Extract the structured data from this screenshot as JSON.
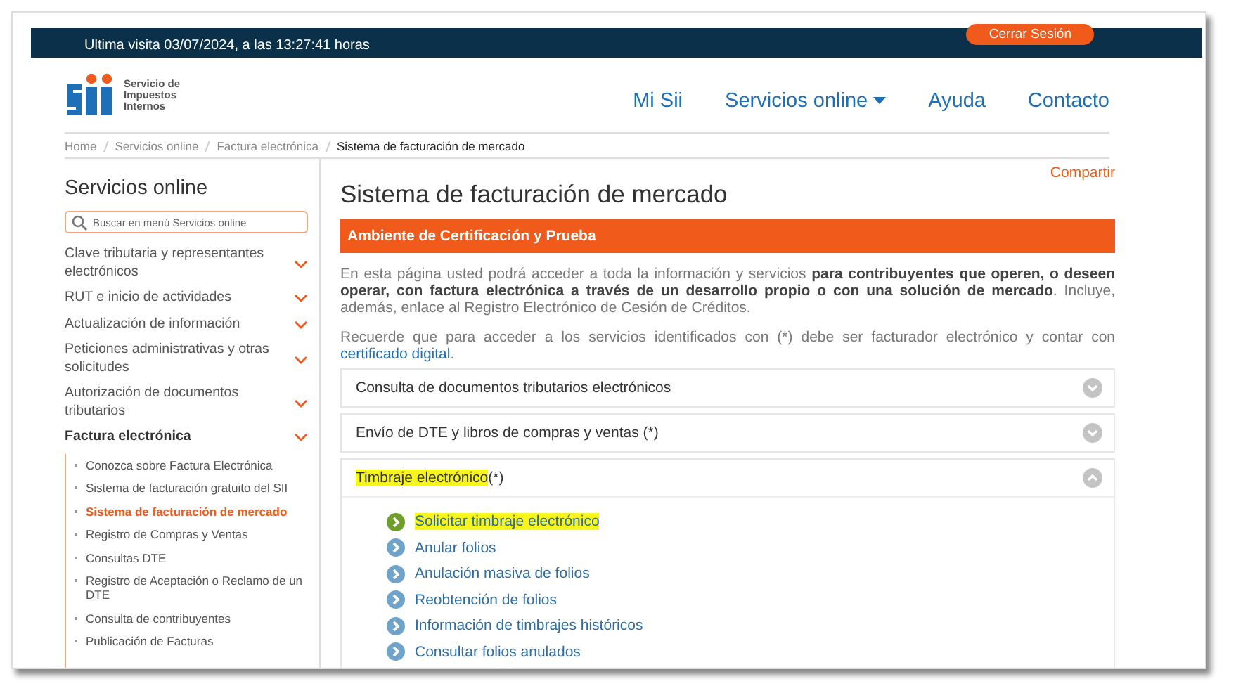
{
  "top_bar": {
    "last_visit": "Ultima visita 03/07/2024, a las 13:27:41 horas",
    "logout_button": "Cerrar Sesión"
  },
  "logo": {
    "lines": [
      "Servicio de",
      "Impuestos",
      "Internos"
    ]
  },
  "nav": [
    {
      "label": "Mi Sii",
      "dropdown": false
    },
    {
      "label": "Servicios online",
      "dropdown": true
    },
    {
      "label": "Ayuda",
      "dropdown": false
    },
    {
      "label": "Contacto",
      "dropdown": false
    }
  ],
  "breadcrumb": [
    "Home",
    "Servicios online",
    "Factura electrónica",
    "Sistema de facturación de mercado"
  ],
  "sidebar": {
    "title": "Servicios online",
    "search": {
      "placeholder": "Buscar en menú Servicios online"
    },
    "items": [
      {
        "label": "Clave tributaria y representantes electrónicos",
        "expanded": false
      },
      {
        "label": "RUT e inicio de actividades",
        "expanded": false
      },
      {
        "label": "Actualización de información",
        "expanded": false
      },
      {
        "label": "Peticiones administrativas y otras solicitudes",
        "expanded": false
      },
      {
        "label": "Autorización de documentos tributarios",
        "expanded": false
      },
      {
        "label": "Factura electrónica",
        "expanded": true,
        "children": [
          {
            "label": "Conozca sobre Factura Electrónica",
            "selected": false
          },
          {
            "label": "Sistema de facturación gratuito del SII",
            "selected": false
          },
          {
            "label": "Sistema de facturación de mercado",
            "selected": true
          },
          {
            "label": "Registro de Compras y Ventas",
            "selected": false
          },
          {
            "label": "Consultas DTE",
            "selected": false
          },
          {
            "label": "Registro de Aceptación o Reclamo de un DTE",
            "selected": false
          },
          {
            "label": "Consulta de contribuyentes",
            "selected": false
          },
          {
            "label": "Publicación de Facturas",
            "selected": false
          }
        ]
      }
    ]
  },
  "main": {
    "title": "Sistema de facturación de mercado",
    "share_link": "Compartir",
    "banner": "Ambiente de Certificación y Prueba",
    "intro": "En esta página usted podrá acceder a toda la información y servicios **para contribuyentes que operen, o deseen operar, con factura electrónica a través de un desarrollo propio o con una solución de mercado**. Incluye, además, enlace al Registro Electrónico de Cesión de Créditos.",
    "note": {
      "text": "Recuerde que para acceder a los servicios identificados con (*) debe ser facturador electrónico y contar con",
      "link": "certificado digital",
      "end": "."
    },
    "accordion": [
      {
        "title": "Consulta de documentos tributarios electrónicos",
        "expanded": false,
        "highlighted": false
      },
      {
        "title": "Envío de DTE y libros de compras y ventas (*)",
        "expanded": false,
        "highlighted": false
      },
      {
        "title": "Timbraje electrónico",
        "suffix": "(*)",
        "expanded": true,
        "highlighted": true,
        "links": [
          {
            "label": "Solicitar timbraje electrónico",
            "highlighted": true
          },
          {
            "label": "Anular folios",
            "highlighted": false
          },
          {
            "label": "Anulación masiva de folios",
            "highlighted": false
          },
          {
            "label": "Reobtención de folios",
            "highlighted": false
          },
          {
            "label": "Información de timbrajes históricos",
            "highlighted": false
          },
          {
            "label": "Consultar folios anulados",
            "highlighted": false
          }
        ]
      }
    ]
  }
}
